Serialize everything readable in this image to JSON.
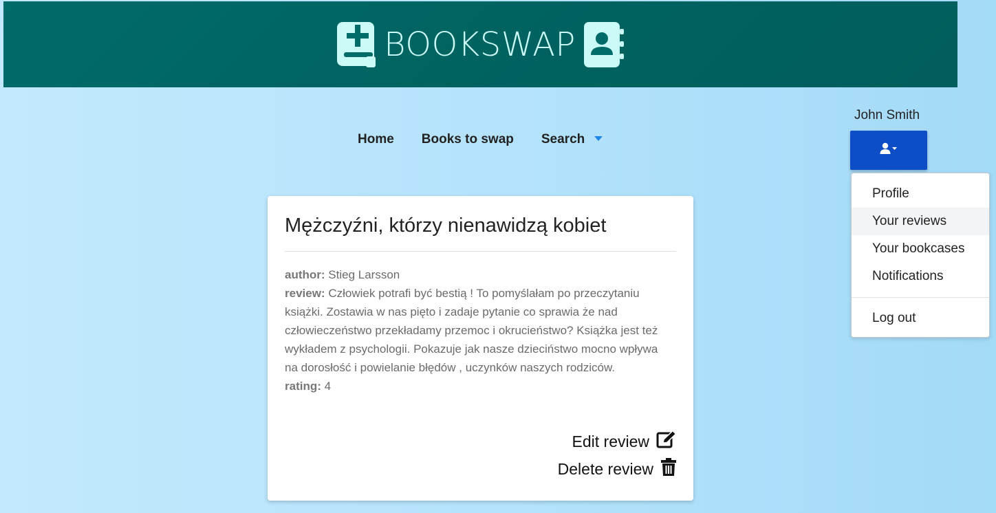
{
  "brand": {
    "name": "BOOKSWAP",
    "left_icon": "book-medical-icon",
    "right_icon": "address-book-icon"
  },
  "user": {
    "name": "John Smith",
    "menu_icon": "user-icon"
  },
  "nav": {
    "home": "Home",
    "books_to_swap": "Books to swap",
    "search": "Search"
  },
  "dropdown": {
    "profile": "Profile",
    "your_reviews": "Your reviews",
    "your_bookcases": "Your bookcases",
    "notifications": "Notifications",
    "log_out": "Log out"
  },
  "review": {
    "title": "Mężczyźni, którzy nienawidzą kobiet",
    "author_label": "author:",
    "author": "Stieg Larsson",
    "review_label": "review:",
    "review_text": "Człowiek potrafi być bestią ! To pomyślałam po przeczytaniu książki. Zostawia w nas pięto i zadaje pytanie co sprawia że nad człowieczeństwo przekładamy przemoc i okrucieństwo? Książka jest też wykładem z psychologii. Pokazuje jak nasze dzieciństwo mocno wpływa na dorosłość i powielanie błędów , uczynków naszych rodziców.",
    "rating_label": "rating:",
    "rating": "4",
    "edit_label": "Edit review",
    "delete_label": "Delete review"
  },
  "colors": {
    "banner": "#006360",
    "accent": "#0d4dc5",
    "logo": "#cbfbf7"
  }
}
